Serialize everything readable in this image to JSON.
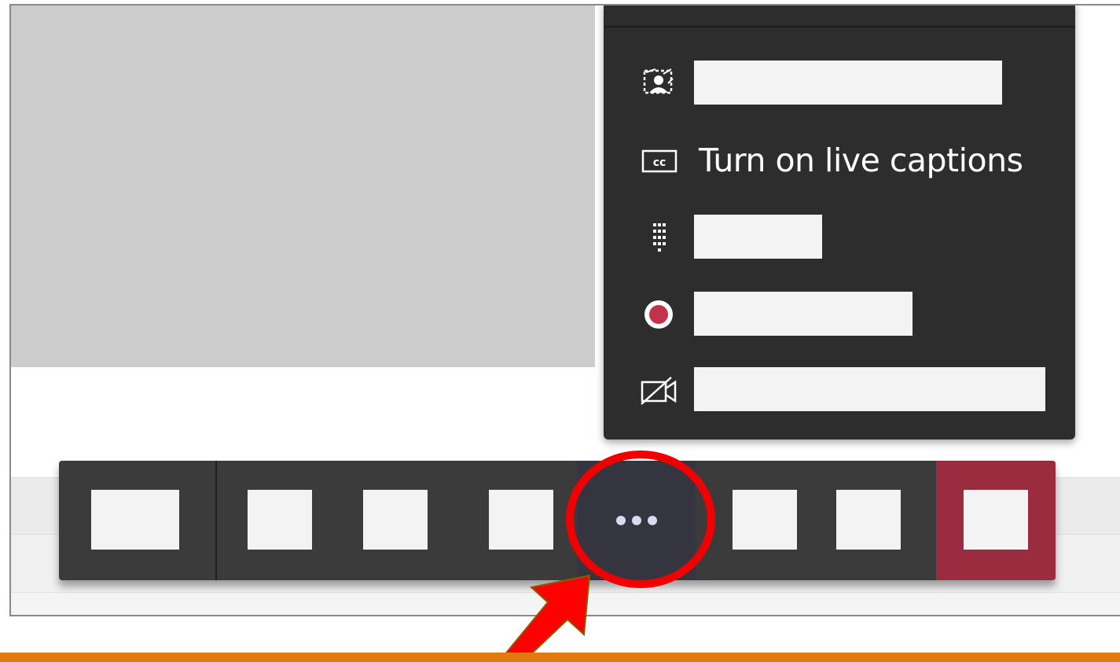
{
  "more_menu": {
    "items": [
      {
        "icon": "background-effects-icon",
        "label": ""
      },
      {
        "icon": "closed-captions-icon",
        "label": "Turn on live captions"
      },
      {
        "icon": "dial-pad-icon",
        "label": ""
      },
      {
        "icon": "record-icon",
        "label": ""
      },
      {
        "icon": "video-off-icon",
        "label": ""
      }
    ]
  },
  "toolbar": {
    "more_button_icon": "more-options-icon"
  },
  "colors": {
    "menu_background": "#2d2d2d",
    "toolbar_background": "#3b3b3b",
    "hangup_red": "#9b2c40",
    "record_red": "#c4314b",
    "annotation_red": "#f00000",
    "accent_orange": "#e27a12"
  }
}
